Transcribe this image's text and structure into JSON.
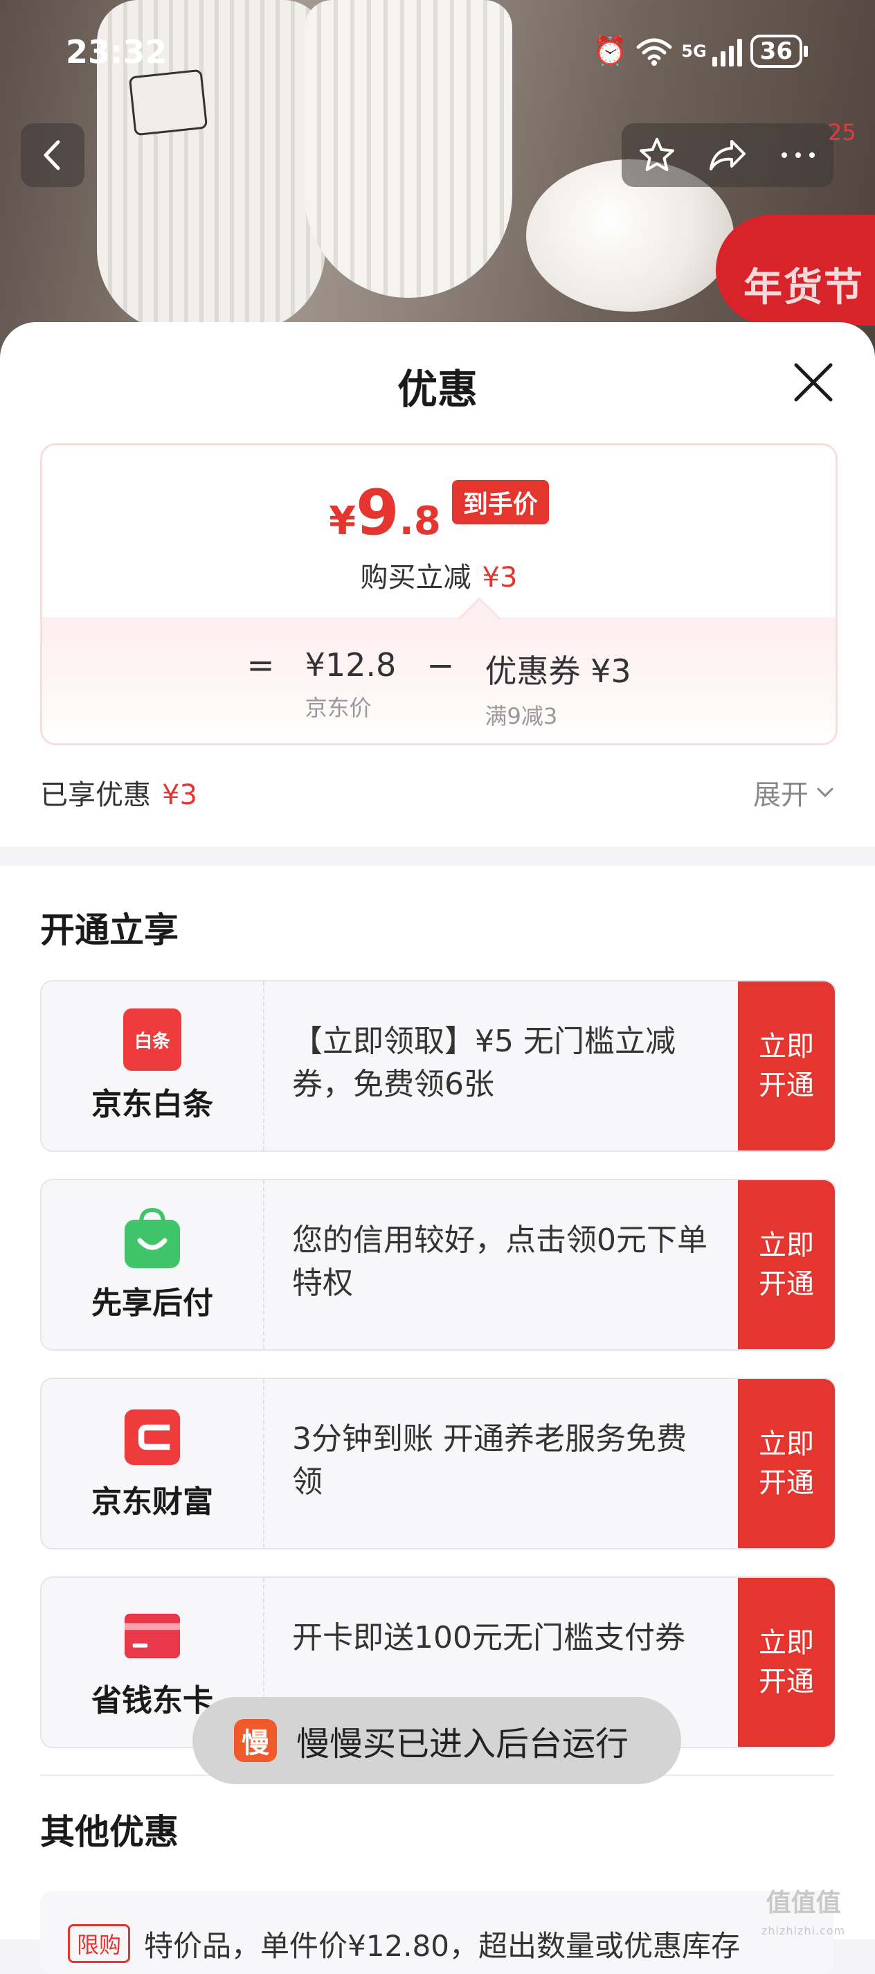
{
  "status_bar": {
    "time": "23:32",
    "net_label": "5G",
    "battery": "36"
  },
  "header": {
    "share_count": "25",
    "promo_badge": "年货节"
  },
  "sheet": {
    "title": "优惠"
  },
  "price_card": {
    "final_symbol": "¥",
    "final_big": "9",
    "final_small": ".8",
    "final_tag": "到手价",
    "reduce_label": "购买立减",
    "reduce_value": "¥3",
    "eq_sign": "=",
    "minus_sign": "−",
    "jd_price_value": "¥12.8",
    "jd_price_label": "京东价",
    "coupon_value": "优惠券 ¥3",
    "coupon_label": "满9减3"
  },
  "enjoyed": {
    "label": "已享优惠",
    "value": "¥3",
    "expand": "展开"
  },
  "open_section": {
    "title": "开通立享",
    "offers": [
      {
        "brand": "京东白条",
        "logo_text": "白条",
        "logo_color": "#ee3b3b",
        "desc": "【立即领取】¥5 无门槛立减券，免费领6张",
        "cta": "立即开通"
      },
      {
        "brand": "先享后付",
        "logo_text": "",
        "logo_color": "#3fc46a",
        "desc": "您的信用较好，点击领0元下单特权",
        "cta": "立即开通"
      },
      {
        "brand": "京东财富",
        "logo_text": "",
        "logo_color": "#ee3b3b",
        "desc": "3分钟到账 开通养老服务免费领",
        "cta": "立即开通"
      },
      {
        "brand": "省钱东卡",
        "logo_text": "",
        "logo_color": "#e8384a",
        "desc": "开卡即送100元无门槛支付券",
        "cta": "立即开通"
      }
    ]
  },
  "other_section": {
    "title": "其他优惠",
    "limit_tag": "限购",
    "text": "特价品，单件价¥12.80，超出数量或优惠库存"
  },
  "toast": {
    "icon_text": "慢",
    "text": "慢慢买已进入后台运行"
  },
  "watermark": {
    "text": "值值值",
    "url": "zhizhizhi.com"
  },
  "colors": {
    "accent": "#e5352f"
  }
}
